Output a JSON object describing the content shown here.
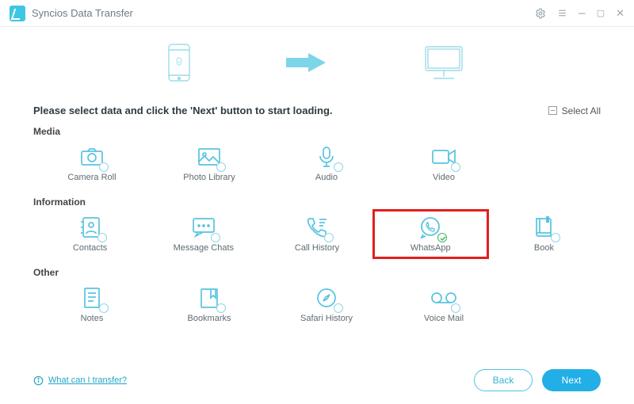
{
  "app": {
    "title": "Syncios Data Transfer"
  },
  "instruction": "Please select data and click the 'Next' button to start loading.",
  "select_all": "Select All",
  "sections": {
    "media": {
      "title": "Media",
      "items": {
        "camera_roll": "Camera Roll",
        "photo_library": "Photo Library",
        "audio": "Audio",
        "video": "Video"
      }
    },
    "information": {
      "title": "Information",
      "items": {
        "contacts": "Contacts",
        "message_chats": "Message Chats",
        "call_history": "Call History",
        "whatsapp": "WhatsApp",
        "book": "Book"
      }
    },
    "other": {
      "title": "Other",
      "items": {
        "notes": "Notes",
        "bookmarks": "Bookmarks",
        "safari_history": "Safari History",
        "voice_mail": "Voice Mail"
      }
    }
  },
  "help_link": "What can I transfer?",
  "buttons": {
    "back": "Back",
    "next": "Next"
  },
  "highlighted_item": "whatsapp",
  "colors": {
    "accent": "#22aee6",
    "icon": "#57c4e0",
    "highlight": "#e21e1e"
  }
}
